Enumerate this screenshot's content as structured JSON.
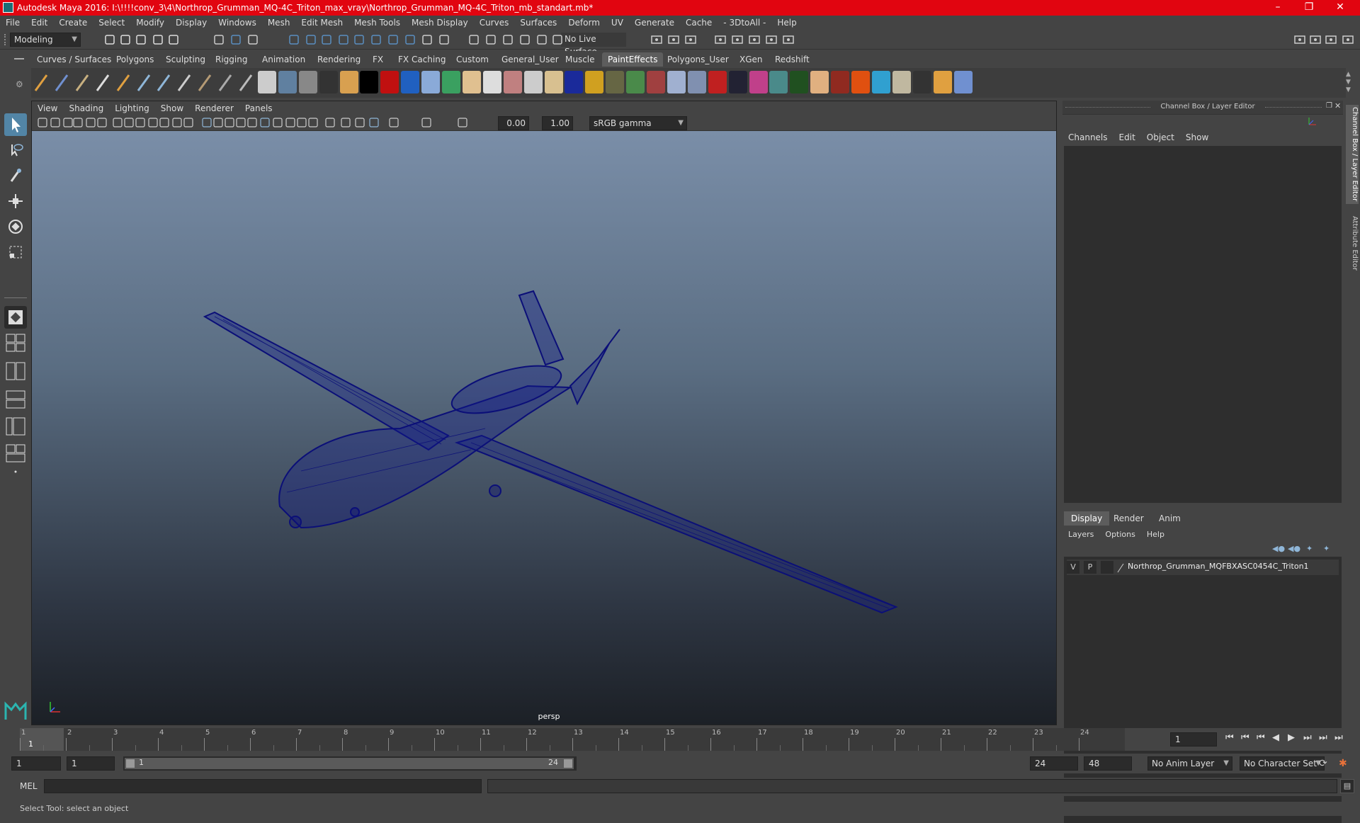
{
  "window": {
    "title": "Autodesk Maya 2016: I:\\!!!!conv_3\\4\\Northrop_Grumman_MQ-4C_Triton_max_vray\\Northrop_Grumman_MQ-4C_Triton_mb_standart.mb*"
  },
  "menu": [
    "File",
    "Edit",
    "Create",
    "Select",
    "Modify",
    "Display",
    "Windows",
    "Mesh",
    "Edit Mesh",
    "Mesh Tools",
    "Mesh Display",
    "Curves",
    "Surfaces",
    "Deform",
    "UV",
    "Generate",
    "Cache",
    "- 3DtoAll -",
    "Help"
  ],
  "statusline": {
    "mode": "Modeling",
    "live_surface": "No Live Surface"
  },
  "shelf_tabs": [
    "Curves / Surfaces",
    "Polygons",
    "Sculpting",
    "Rigging",
    "Animation",
    "Rendering",
    "FX",
    "FX Caching",
    "Custom",
    "General_User",
    "Muscle",
    "PaintEffects",
    "Polygons_User",
    "XGen",
    "Redshift"
  ],
  "shelf_active": "PaintEffects",
  "viewport": {
    "menu": [
      "View",
      "Shading",
      "Lighting",
      "Show",
      "Renderer",
      "Panels"
    ],
    "exposure": "0.00",
    "gamma": "1.00",
    "colorspace": "sRGB gamma",
    "camera": "persp"
  },
  "channel_box": {
    "title": "Channel Box / Layer Editor",
    "menu": [
      "Channels",
      "Edit",
      "Object",
      "Show"
    ]
  },
  "layer_editor": {
    "tabs": [
      "Display",
      "Render",
      "Anim"
    ],
    "active_tab": "Display",
    "menu": [
      "Layers",
      "Options",
      "Help"
    ],
    "layers": [
      {
        "v": "V",
        "p": "P",
        "name": "Northrop_Grumman_MQFBXASC0454C_Triton1"
      }
    ]
  },
  "side_tabs": [
    "Channel Box / Layer Editor",
    "Attribute Editor"
  ],
  "timeline": {
    "ticks": [
      "1",
      "2",
      "3",
      "4",
      "5",
      "6",
      "7",
      "8",
      "9",
      "10",
      "11",
      "12",
      "13",
      "14",
      "15",
      "16",
      "17",
      "18",
      "19",
      "20",
      "21",
      "22",
      "23",
      "24"
    ],
    "current_frame_marker": "1",
    "current_frame": "1"
  },
  "range": {
    "start": "1",
    "playback_start": "1",
    "slider_start": "1",
    "slider_end": "24",
    "playback_end": "24",
    "end": "48",
    "anim_layer": "No Anim Layer",
    "character_set": "No Character Set"
  },
  "command": {
    "label": "MEL"
  },
  "help_line": "Select Tool: select an object"
}
